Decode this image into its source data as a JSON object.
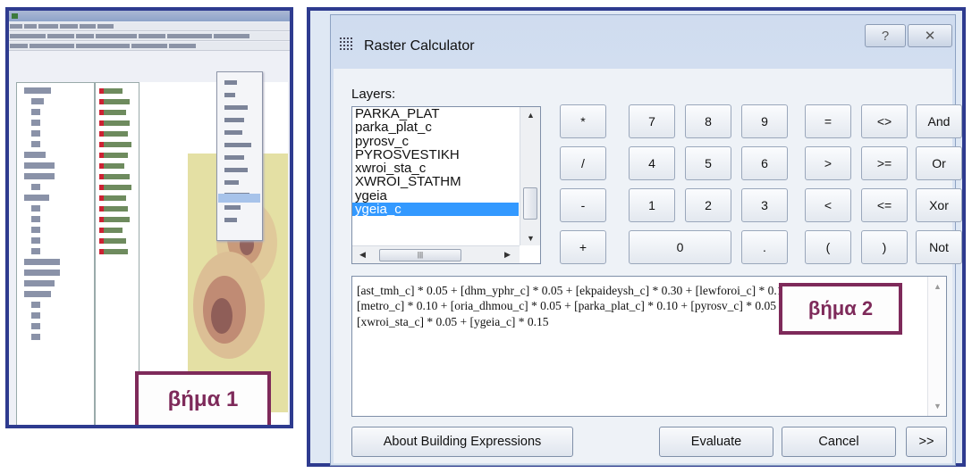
{
  "step1": {
    "label": "βήμα 1"
  },
  "dialog": {
    "title": "Raster Calculator",
    "help_label": "?",
    "close_label": "✕"
  },
  "layers": {
    "label": "Layers:",
    "items": [
      "PARKA_PLAT",
      "parka_plat_c",
      "pyrosv_c",
      "PYROSVESTIKH",
      "xwroi_sta_c",
      "XWROI_STATHM",
      "ygeia",
      "ygeia_c"
    ],
    "selected": "ygeia_c"
  },
  "buttons": {
    "mul": "*",
    "seven": "7",
    "eight": "8",
    "nine": "9",
    "eq": "=",
    "neq": "<>",
    "and": "And",
    "div": "/",
    "four": "4",
    "five": "5",
    "six": "6",
    "gt": ">",
    "gte": ">=",
    "or": "Or",
    "minus": "-",
    "one": "1",
    "two": "2",
    "three": "3",
    "lt": "<",
    "lte": "<=",
    "xor": "Xor",
    "plus": "+",
    "zero": "0",
    "dot": ".",
    "lparen": "(",
    "rparen": ")",
    "not": "Not"
  },
  "expression": {
    "line1": "[ast_tmh_c] * 0.05 + [dhm_yphr_c] * 0.05 + [ekpaideysh_c] * 0.30 + [lewforoi_c] * 0.10 +",
    "line2": "[metro_c] * 0.10 + [oria_dhmou_c] * 0.05 + [parka_plat_c] * 0.10 + [pyrosv_c] * 0.05 +",
    "line3": "[xwroi_sta_c] * 0.05 + [ygeia_c] * 0.15"
  },
  "step2": {
    "label": "βήμα 2"
  },
  "footer": {
    "about": "About Building Expressions",
    "evaluate": "Evaluate",
    "cancel": "Cancel",
    "more": ">>"
  },
  "colors": {
    "frame": "#2e3b8f",
    "step_box": "#7e2a5a",
    "selection": "#3399ff"
  }
}
